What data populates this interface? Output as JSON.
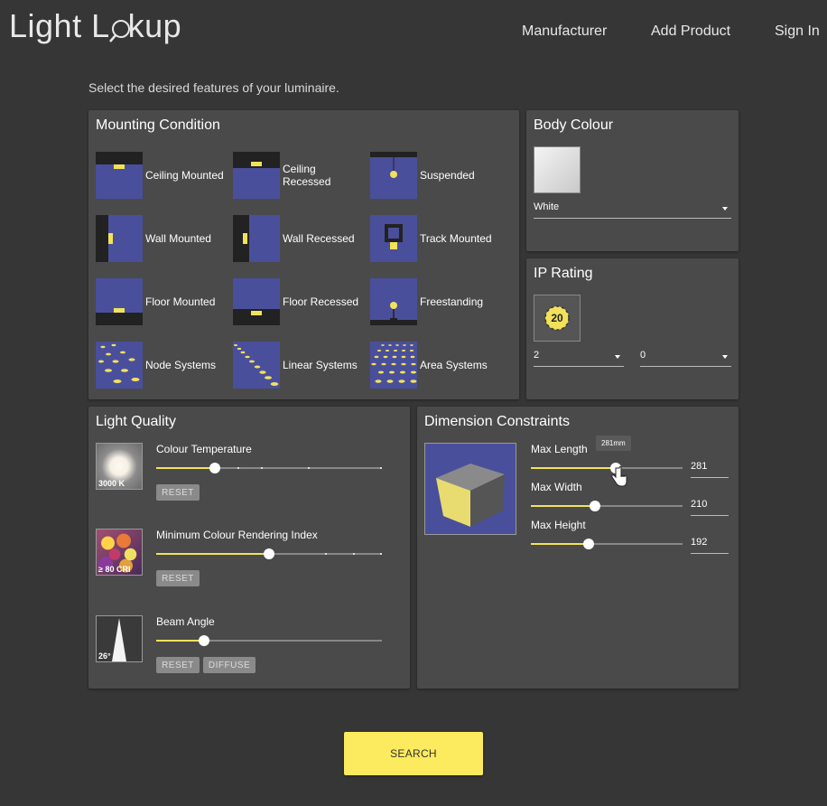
{
  "header": {
    "logo_left": "Light L",
    "logo_right": "kup",
    "nav": [
      "Manufacturer",
      "Add Product",
      "Sign In"
    ]
  },
  "intro": "Select the desired features of your luminaire.",
  "mounting": {
    "title": "Mounting Condition",
    "options": [
      "Ceiling Mounted",
      "Ceiling Recessed",
      "Suspended",
      "Wall Mounted",
      "Wall Recessed",
      "Track Mounted",
      "Floor Mounted",
      "Floor Recessed",
      "Freestanding",
      "Node Systems",
      "Linear Systems",
      "Area Systems"
    ]
  },
  "body_colour": {
    "title": "Body Colour",
    "selected": "White"
  },
  "ip_rating": {
    "title": "IP Rating",
    "badge": "20",
    "first_digit": "2",
    "second_digit": "0"
  },
  "light_quality": {
    "title": "Light Quality",
    "colour_temp": {
      "label": "Colour Temperature",
      "thumb_caption": "3000 K",
      "reset": "RESET",
      "level": 0.26
    },
    "cri": {
      "label": "Minimum Colour Rendering Index",
      "thumb_caption": "≥ 80 CRI",
      "reset": "RESET",
      "level": 0.5
    },
    "beam": {
      "label": "Beam Angle",
      "thumb_caption": "26°",
      "reset": "RESET",
      "diffuse": "DIFFUSE",
      "level": 0.21
    }
  },
  "dimensions": {
    "title": "Dimension Constraints",
    "length": {
      "label": "Max Length",
      "value": "281",
      "tooltip": "281mm",
      "level": 0.56
    },
    "width": {
      "label": "Max Width",
      "value": "210",
      "level": 0.42
    },
    "height": {
      "label": "Max Height",
      "value": "192",
      "level": 0.38
    }
  },
  "colors": {
    "accent": "#fceb5e",
    "thumb_blue": "#4a4f9c",
    "panel": "#4a4a4a",
    "background": "#363636"
  },
  "search_label": "SEARCH"
}
